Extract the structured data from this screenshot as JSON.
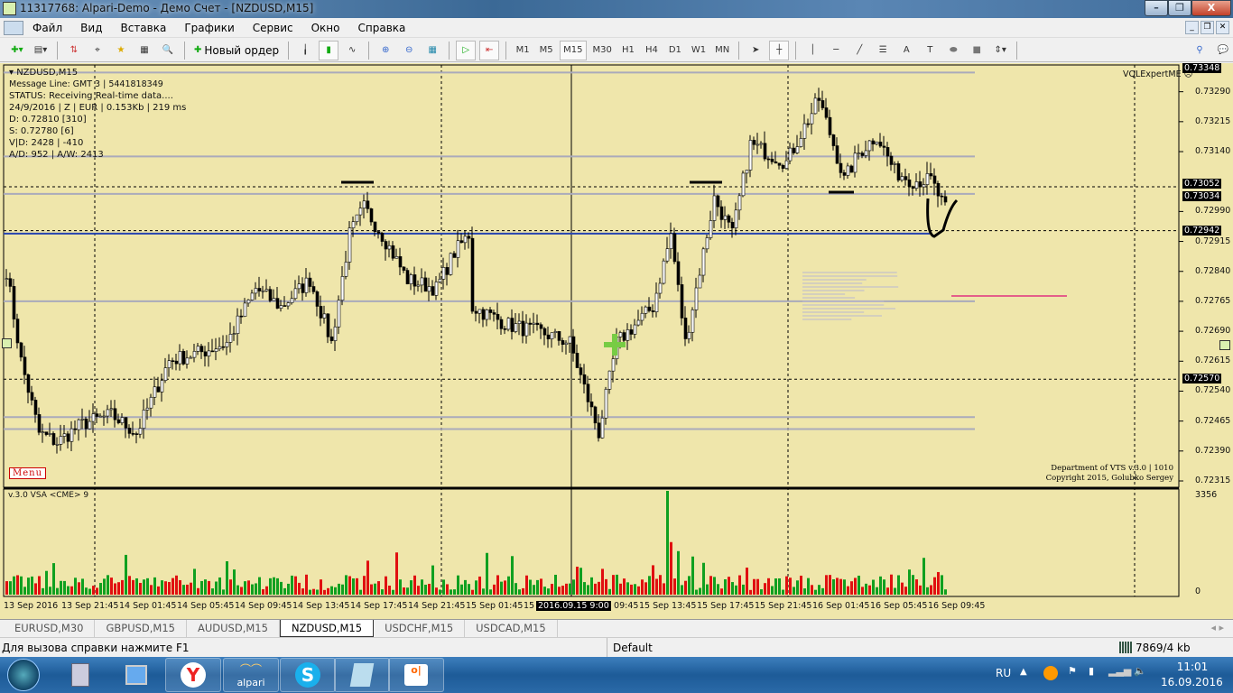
{
  "window": {
    "title": "11317768: Alpari-Demo - Демо Счет - [NZDUSD,M15]",
    "min": "–",
    "restore": "❐",
    "close": "X"
  },
  "menu": [
    "Файл",
    "Вид",
    "Вставка",
    "Графики",
    "Сервис",
    "Окно",
    "Справка"
  ],
  "toolbar": {
    "new_order": "Новый ордер",
    "timeframes": [
      "M1",
      "M5",
      "M15",
      "M30",
      "H1",
      "H4",
      "D1",
      "W1",
      "MN"
    ],
    "active_tf": "M15"
  },
  "chart": {
    "symbol": "NZDUSD,M15",
    "info_lines": [
      "Message Line: GMT 3 | 5441818349",
      "STATUS:  Receiving Real-time data....",
      "24/9/2016 | Z | EUR | 0.153Kb | 219 ms",
      "D: 0.72810  [310]",
      "S: 0.72780  [6]",
      "V|D: 2428 | -410",
      "A/D: 952 | A/W: 2413"
    ],
    "expert": "VQLExpertME ☹",
    "menu_button": "Menu",
    "copyright": [
      "Department of VTS  v.3.0 | 1010",
      "Copyright 2015, Golubko Sergey"
    ],
    "price_ticks": [
      "0.73290",
      "0.73215",
      "0.73140",
      "0.72990",
      "0.72915",
      "0.72840",
      "0.72765",
      "0.72690",
      "0.72615",
      "0.72540",
      "0.72465",
      "0.72390",
      "0.72315"
    ],
    "price_tags": [
      "0.73348",
      "0.73052",
      "0.73034",
      "0.72942",
      "0.72570"
    ],
    "time_labels": [
      "13 Sep 2016",
      "13 Sep 21:45",
      "14 Sep 01:45",
      "14 Sep 05:45",
      "14 Sep 09:45",
      "14 Sep 13:45",
      "14 Sep 17:45",
      "14 Sep 21:45",
      "15 Sep 01:45",
      "15",
      "15 Sep 09:45",
      "15 Sep 13:45",
      "15 Sep 17:45",
      "15 Sep 21:45",
      "16 Sep 01:45",
      "16 Sep 05:45",
      "16 Sep 09:45"
    ],
    "cursor_time": "2016.09.15 9:00",
    "indicator": {
      "title": "v.3.0 VSA <CME> 9",
      "max": "3356",
      "min": "0"
    }
  },
  "chart_data": {
    "type": "candlestick",
    "ylim": [
      0.72315,
      0.73348
    ],
    "anchors": [
      [
        0,
        0.72842
      ],
      [
        4,
        0.72616
      ],
      [
        9,
        0.72435
      ],
      [
        14,
        0.72412
      ],
      [
        21,
        0.72458
      ],
      [
        29,
        0.7248
      ],
      [
        36,
        0.72435
      ],
      [
        45,
        0.72616
      ],
      [
        54,
        0.72638
      ],
      [
        61,
        0.72661
      ],
      [
        69,
        0.72797
      ],
      [
        76,
        0.72751
      ],
      [
        84,
        0.72819
      ],
      [
        90,
        0.72661
      ],
      [
        95,
        0.72932
      ],
      [
        99,
        0.73
      ],
      [
        104,
        0.72932
      ],
      [
        111,
        0.72819
      ],
      [
        119,
        0.72797
      ],
      [
        124,
        0.72887
      ],
      [
        128,
        0.72932
      ],
      [
        129,
        0.72751
      ],
      [
        139,
        0.72706
      ],
      [
        149,
        0.72684
      ],
      [
        156,
        0.72661
      ],
      [
        160,
        0.72548
      ],
      [
        164,
        0.72435
      ],
      [
        169,
        0.72661
      ],
      [
        174,
        0.72706
      ],
      [
        179,
        0.72751
      ],
      [
        184,
        0.72932
      ],
      [
        188,
        0.72661
      ],
      [
        191,
        0.72797
      ],
      [
        196,
        0.73023
      ],
      [
        201,
        0.72932
      ],
      [
        206,
        0.73158
      ],
      [
        211,
        0.73136
      ],
      [
        216,
        0.73113
      ],
      [
        221,
        0.73203
      ],
      [
        225,
        0.73271
      ],
      [
        229,
        0.73158
      ],
      [
        232,
        0.73068
      ],
      [
        236,
        0.73136
      ],
      [
        241,
        0.73181
      ],
      [
        246,
        0.7309
      ],
      [
        251,
        0.73068
      ],
      [
        256,
        0.73068
      ],
      [
        260,
        0.72995
      ]
    ]
  },
  "tabs": [
    "EURUSD,M30",
    "GBPUSD,M15",
    "AUDUSD,M15",
    "NZDUSD,M15",
    "USDCHF,M15",
    "USDCAD,M15"
  ],
  "active_tab": "NZDUSD,M15",
  "status": {
    "help": "Для вызова справки нажмите F1",
    "profile": "Default",
    "traffic": "7869/4 kb"
  },
  "taskbar": {
    "alpari": "alpari",
    "lang": "RU",
    "time": "11:01",
    "date": "16.09.2016"
  }
}
